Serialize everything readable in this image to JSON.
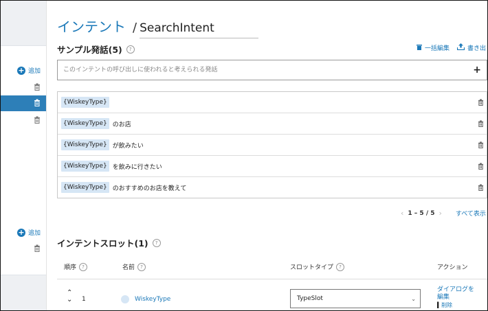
{
  "sidebar": {
    "add_label_1": "追加",
    "add_label_2": "追加"
  },
  "header": {
    "breadcrumb_link": "インテント",
    "separator": "/",
    "intent_name": "SearchIntent"
  },
  "utterances": {
    "title": "サンプル発話(5)",
    "help": "?",
    "bulk_edit_label": "一括編集",
    "export_label": "書き出",
    "input_placeholder": "このインテントの呼び出しに使われると考えられる発話",
    "add_symbol": "+",
    "rows": [
      {
        "slot": "{WiskeyType}",
        "text": ""
      },
      {
        "slot": "{WiskeyType}",
        "text": "のお店"
      },
      {
        "slot": "{WiskeyType}",
        "text": "が飲みたい"
      },
      {
        "slot": "{WiskeyType}",
        "text": "を飲みに行きたい"
      },
      {
        "slot": "{WiskeyType}",
        "text": "のおすすめのお店を教えて"
      }
    ],
    "pagination": "1 – 5 / 5",
    "show_all": "すべて表示"
  },
  "slots": {
    "title": "インテントスロット(1)",
    "help": "?",
    "columns": {
      "order": "順序",
      "name": "名前",
      "slot_type": "スロットタイプ",
      "action": "アクション"
    },
    "rows": [
      {
        "order": "1",
        "name": "WiskeyType",
        "slot_type": "TypeSlot",
        "action_dialog": "ダイアログを",
        "action_edit": "編集",
        "action_delete": "削除"
      }
    ]
  },
  "colors": {
    "accent": "#1a78b8",
    "slot_tag_bg": "#d6e6f5",
    "selected_sidebar": "#2d7fb8"
  }
}
